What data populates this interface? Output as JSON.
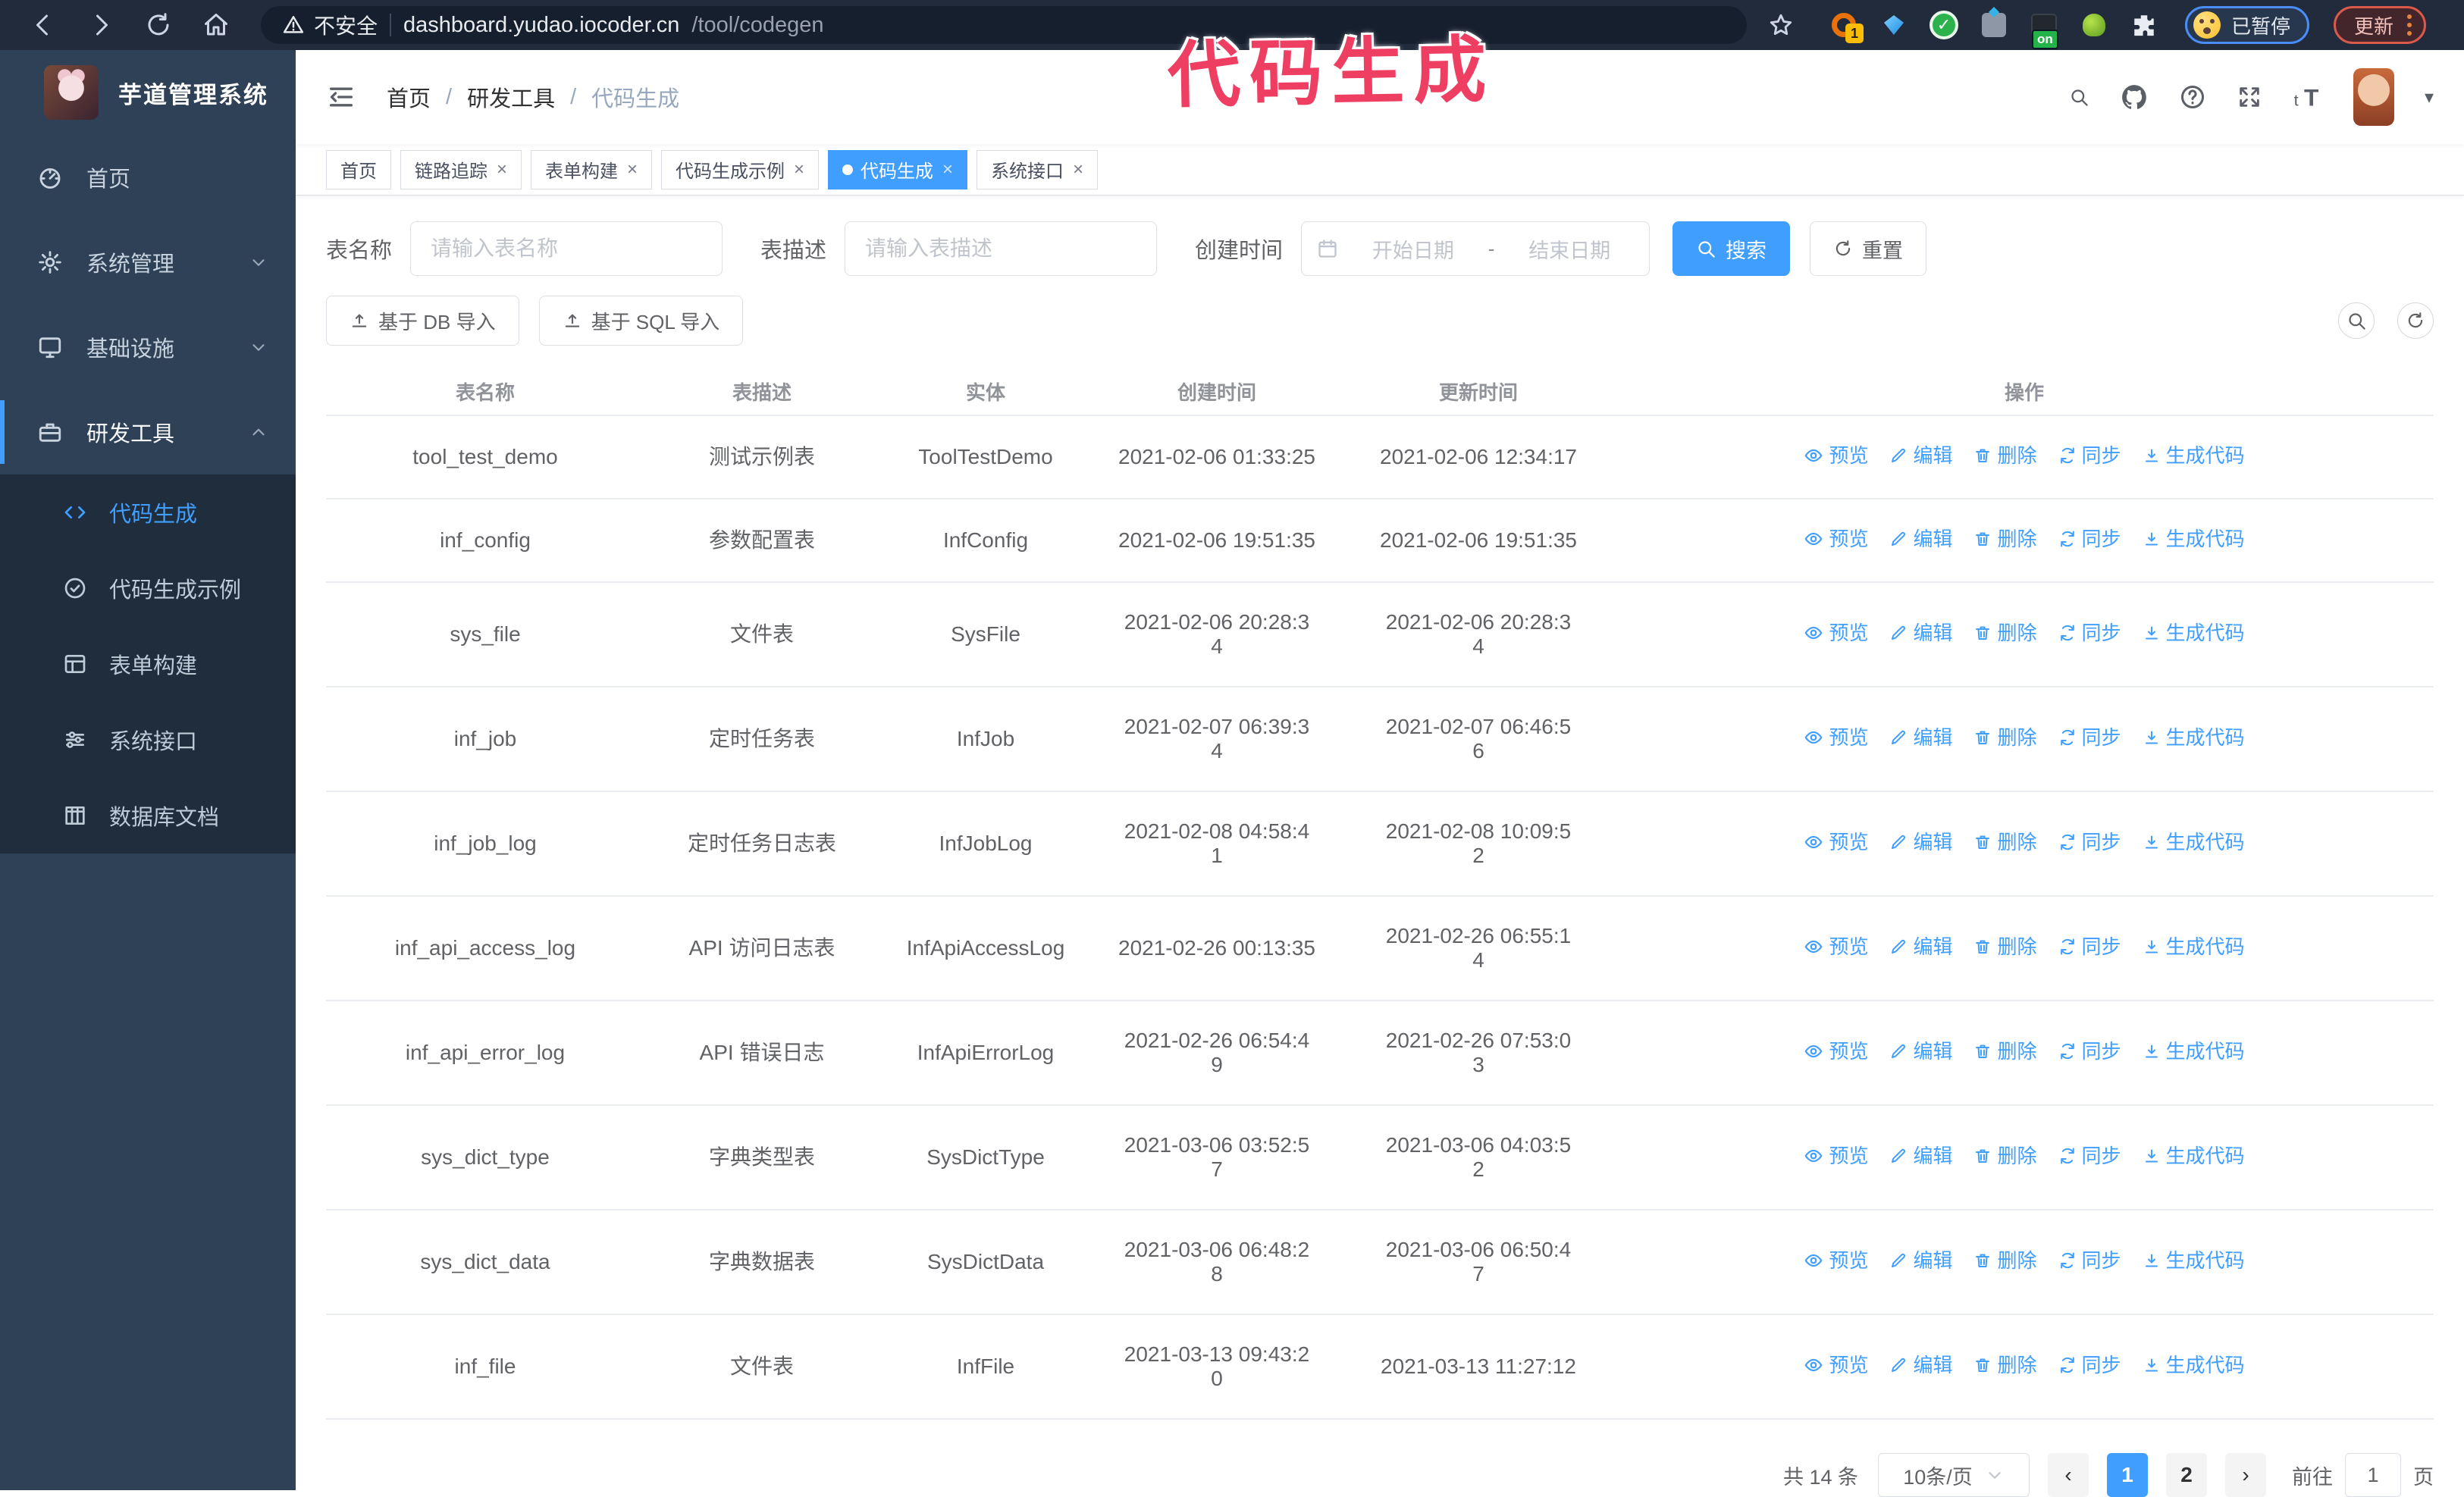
{
  "colors": {
    "accent": "#409eff",
    "sidebar_bg": "#2e4156",
    "submenu_bg": "#1f2d3d",
    "annotation": "#ee3f63",
    "tag_active": "#409eff"
  },
  "browser": {
    "security_label": "不安全",
    "url_host": "dashboard.yudao.iocoder.cn",
    "url_path": "/tool/codegen",
    "extension_badge": "1",
    "extension_on_badge": "on",
    "shield_check": "✓",
    "paused_badge": "已暂停",
    "update_button": "更新"
  },
  "annotation": {
    "text": "代码生成"
  },
  "sidebar": {
    "logo_title": "芋道管理系统",
    "menu": [
      {
        "name": "home",
        "label": "首页",
        "icon": "gauge-icon",
        "arrow": ""
      },
      {
        "name": "system",
        "label": "系统管理",
        "icon": "gear-icon",
        "arrow": "chevron-down-icon"
      },
      {
        "name": "infra",
        "label": "基础设施",
        "icon": "monitor-icon",
        "arrow": "chevron-down-icon"
      },
      {
        "name": "devtools",
        "label": "研发工具",
        "icon": "briefcase-icon",
        "arrow": "chevron-up-icon",
        "active": true
      }
    ],
    "submenu": [
      {
        "name": "codegen",
        "label": "代码生成",
        "icon": "code-icon",
        "active": true
      },
      {
        "name": "codegen-example",
        "label": "代码生成示例",
        "icon": "badge-check-icon"
      },
      {
        "name": "form-builder",
        "label": "表单构建",
        "icon": "form-icon"
      },
      {
        "name": "api",
        "label": "系统接口",
        "icon": "sliders-icon"
      },
      {
        "name": "db-doc",
        "label": "数据库文档",
        "icon": "database-icon"
      }
    ]
  },
  "header": {
    "breadcrumb": [
      {
        "label": "首页"
      },
      {
        "label": "研发工具"
      },
      {
        "label": "代码生成",
        "current": true
      }
    ],
    "separator": "/"
  },
  "tags": [
    {
      "name": "home",
      "label": "首页"
    },
    {
      "name": "tracing",
      "label": "链路追踪",
      "closable": true
    },
    {
      "name": "form-builder",
      "label": "表单构建",
      "closable": true
    },
    {
      "name": "codegen-example",
      "label": "代码生成示例",
      "closable": true
    },
    {
      "name": "codegen",
      "label": "代码生成",
      "closable": true,
      "active": true
    },
    {
      "name": "api",
      "label": "系统接口",
      "closable": true
    }
  ],
  "filters": {
    "name_label": "表名称",
    "name_placeholder": "请输入表名称",
    "desc_label": "表描述",
    "desc_placeholder": "请输入表描述",
    "time_label": "创建时间",
    "start_placeholder": "开始日期",
    "range_separator": "-",
    "end_placeholder": "结束日期",
    "search_button": "搜索",
    "reset_button": "重置"
  },
  "toolbar": {
    "import_db_button": "基于 DB 导入",
    "import_sql_button": "基于 SQL 导入"
  },
  "table": {
    "columns": [
      "表名称",
      "表描述",
      "实体",
      "创建时间",
      "更新时间",
      "操作"
    ],
    "actions": [
      {
        "label": "预览",
        "icon": "eye-icon"
      },
      {
        "label": "编辑",
        "icon": "edit-icon"
      },
      {
        "label": "删除",
        "icon": "delete-icon"
      },
      {
        "label": "同步",
        "icon": "sync-icon"
      },
      {
        "label": "生成代码",
        "icon": "download-icon"
      }
    ],
    "rows": [
      {
        "name": "tool_test_demo",
        "desc": "测试示例表",
        "entity": "ToolTestDemo",
        "create_lines": [
          "2021-02-06 01:33:25"
        ],
        "update_lines": [
          "2021-02-06 12:34:17"
        ]
      },
      {
        "name": "inf_config",
        "desc": "参数配置表",
        "entity": "InfConfig",
        "create_lines": [
          "2021-02-06 19:51:35"
        ],
        "update_lines": [
          "2021-02-06 19:51:35"
        ]
      },
      {
        "name": "sys_file",
        "desc": "文件表",
        "entity": "SysFile",
        "create_lines": [
          "2021-02-06 20:28:3",
          "4"
        ],
        "update_lines": [
          "2021-02-06 20:28:3",
          "4"
        ]
      },
      {
        "name": "inf_job",
        "desc": "定时任务表",
        "entity": "InfJob",
        "create_lines": [
          "2021-02-07 06:39:3",
          "4"
        ],
        "update_lines": [
          "2021-02-07 06:46:5",
          "6"
        ]
      },
      {
        "name": "inf_job_log",
        "desc": "定时任务日志表",
        "entity": "InfJobLog",
        "create_lines": [
          "2021-02-08 04:58:4",
          "1"
        ],
        "update_lines": [
          "2021-02-08 10:09:5",
          "2"
        ]
      },
      {
        "name": "inf_api_access_log",
        "desc": "API 访问日志表",
        "entity": "InfApiAccessLog",
        "create_lines": [
          "2021-02-26 00:13:35"
        ],
        "update_lines": [
          "2021-02-26 06:55:1",
          "4"
        ]
      },
      {
        "name": "inf_api_error_log",
        "desc": "API 错误日志",
        "entity": "InfApiErrorLog",
        "create_lines": [
          "2021-02-26 06:54:4",
          "9"
        ],
        "update_lines": [
          "2021-02-26 07:53:0",
          "3"
        ]
      },
      {
        "name": "sys_dict_type",
        "desc": "字典类型表",
        "entity": "SysDictType",
        "create_lines": [
          "2021-03-06 03:52:5",
          "7"
        ],
        "update_lines": [
          "2021-03-06 04:03:5",
          "2"
        ]
      },
      {
        "name": "sys_dict_data",
        "desc": "字典数据表",
        "entity": "SysDictData",
        "create_lines": [
          "2021-03-06 06:48:2",
          "8"
        ],
        "update_lines": [
          "2021-03-06 06:50:4",
          "7"
        ]
      },
      {
        "name": "inf_file",
        "desc": "文件表",
        "entity": "InfFile",
        "create_lines": [
          "2021-03-13 09:43:2",
          "0"
        ],
        "update_lines": [
          "2021-03-13 11:27:12"
        ]
      }
    ]
  },
  "pagination": {
    "total": "共 14 条",
    "page_size": "10条/页",
    "pages": [
      "1",
      "2"
    ],
    "active_page": "1",
    "goto_label": "前往",
    "goto_value": "1",
    "page_unit": "页"
  }
}
